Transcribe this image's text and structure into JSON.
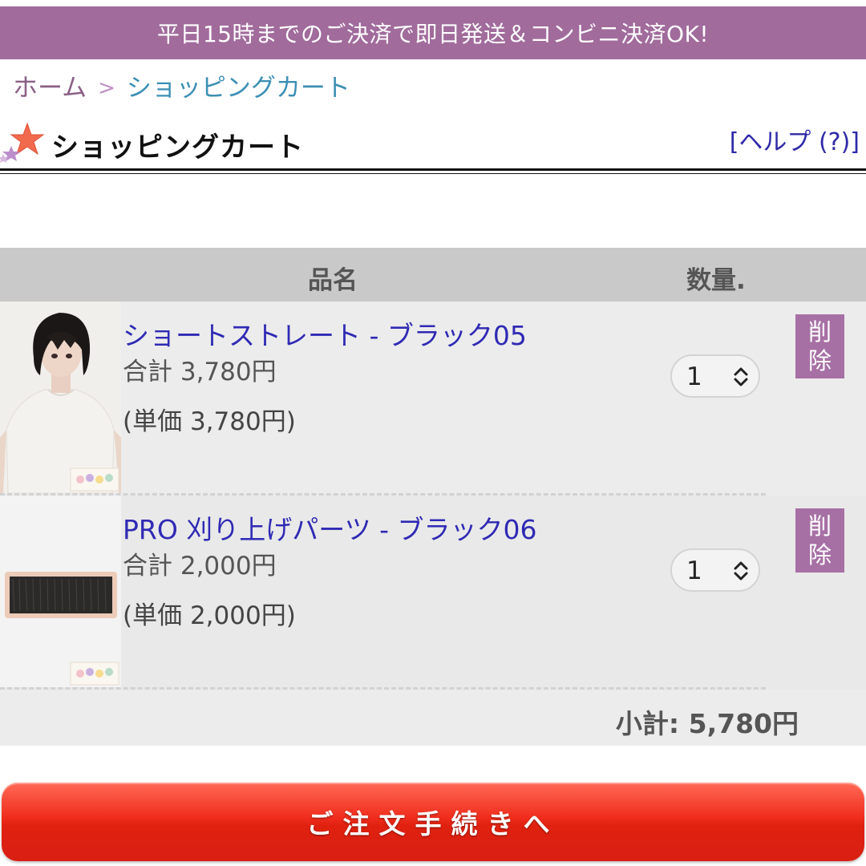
{
  "banner": {
    "text": "平日15時までのご決済で即日発送＆コンビニ決済OK!"
  },
  "breadcrumb": {
    "home": "ホーム",
    "separator": ">",
    "current": "ショッピングカート"
  },
  "header": {
    "title": "ショッピングカート",
    "help": "[ヘルプ (?)]"
  },
  "table": {
    "col_name": "品名",
    "col_qty": "数量."
  },
  "items": [
    {
      "name": "ショートストレート - ブラック05",
      "total": "合計 3,780円",
      "unit": "(単価 3,780円)",
      "qty": "1",
      "delete_line1": "削",
      "delete_line2": "除",
      "thumb_icon": "wig-model-photo"
    },
    {
      "name": "PRO 刈り上げパーツ - ブラック06",
      "total": "合計 2,000円",
      "unit": "(単価 2,000円)",
      "qty": "1",
      "delete_line1": "削",
      "delete_line2": "除",
      "thumb_icon": "hair-part-photo"
    }
  ],
  "subtotal": "小計: 5,780円",
  "checkout": {
    "label": "ご注文手続きへ"
  },
  "colors": {
    "banner": "#a16b9c",
    "link": "#2f2ab4",
    "delete": "#a770a5",
    "checkout": "#e02110"
  }
}
